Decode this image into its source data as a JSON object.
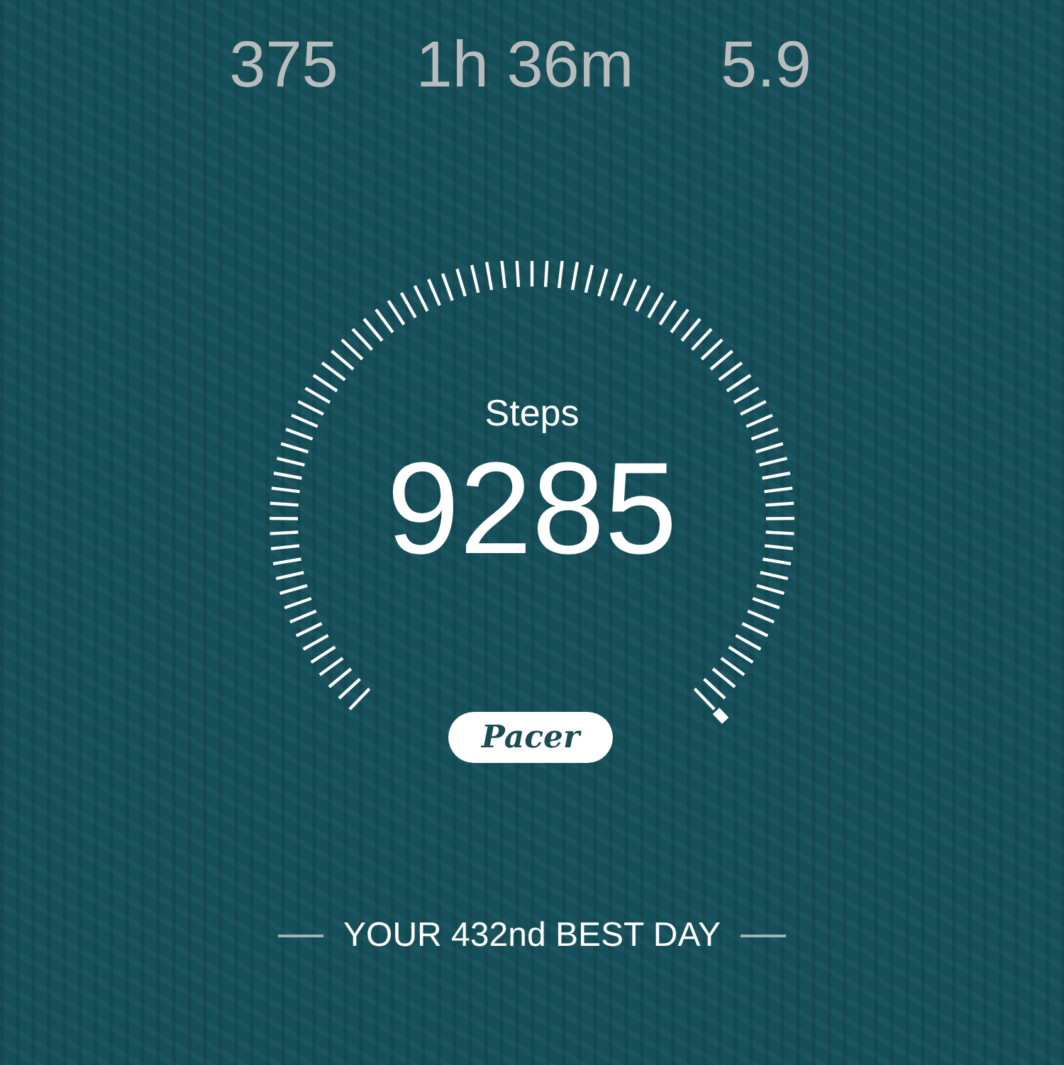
{
  "stats": [
    {
      "value": "375"
    },
    {
      "value": "1h 36m"
    },
    {
      "value": "5.9"
    }
  ],
  "gauge": {
    "label": "Steps",
    "value": "9285"
  },
  "badge": "Pacer",
  "footer": "YOUR 432nd BEST DAY"
}
